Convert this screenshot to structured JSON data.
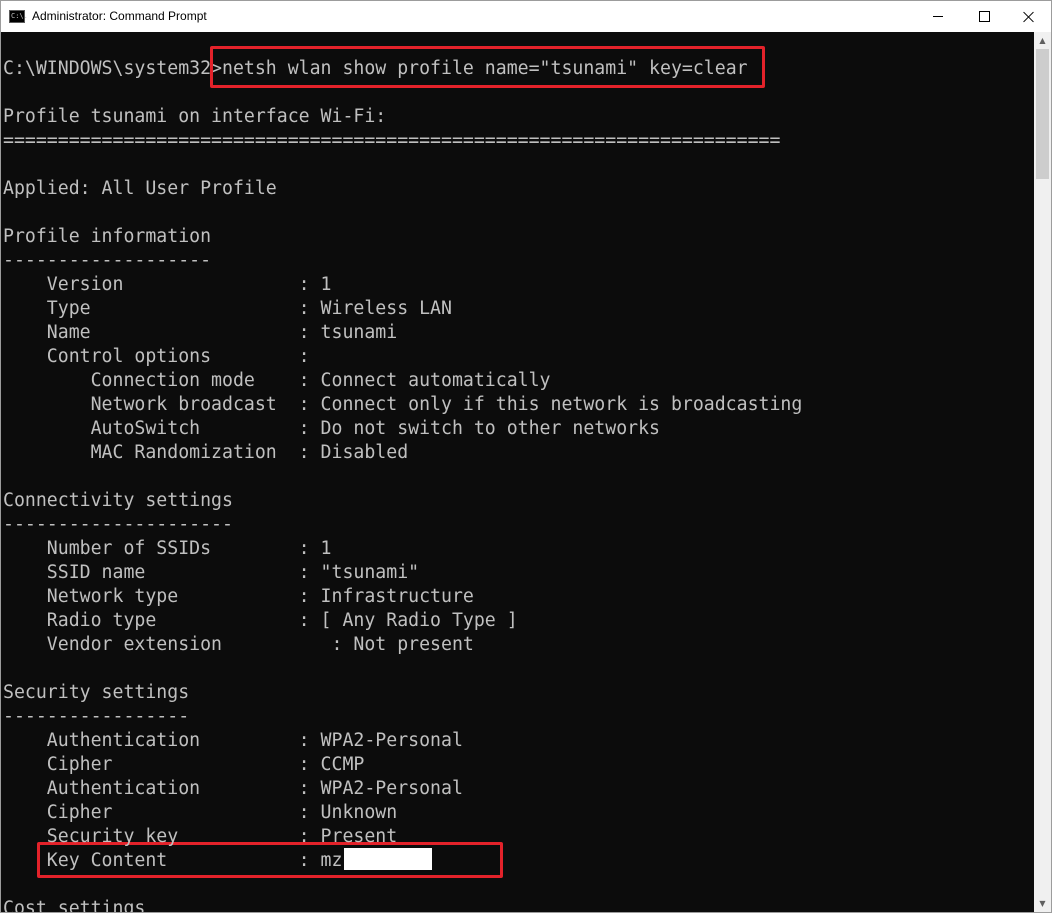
{
  "window": {
    "title": "Administrator: Command Prompt",
    "icon_label": "C:\\."
  },
  "console": {
    "prompt": "C:\\WINDOWS\\system32>",
    "command": "netsh wlan show profile name=\"tsunami\" key=clear",
    "lines": [
      "Profile tsunami on interface Wi-Fi:",
      "=======================================================================",
      "",
      "Applied: All User Profile",
      "",
      "Profile information",
      "-------------------",
      "    Version                : 1",
      "    Type                   : Wireless LAN",
      "    Name                   : tsunami",
      "    Control options        :",
      "        Connection mode    : Connect automatically",
      "        Network broadcast  : Connect only if this network is broadcasting",
      "        AutoSwitch         : Do not switch to other networks",
      "        MAC Randomization  : Disabled",
      "",
      "Connectivity settings",
      "---------------------",
      "    Number of SSIDs        : 1",
      "    SSID name              : \"tsunami\"",
      "    Network type           : Infrastructure",
      "    Radio type             : [ Any Radio Type ]",
      "    Vendor extension          : Not present",
      "",
      "Security settings",
      "-----------------",
      "    Authentication         : WPA2-Personal",
      "    Cipher                 : CCMP",
      "    Authentication         : WPA2-Personal",
      "    Cipher                 : Unknown",
      "    Security key           : Present",
      "    Key Content            : mz",
      "",
      "Cost settings"
    ]
  },
  "colors": {
    "console_bg": "#0c0c0c",
    "console_text": "#c0c0c0",
    "highlight": "#e3222a"
  }
}
